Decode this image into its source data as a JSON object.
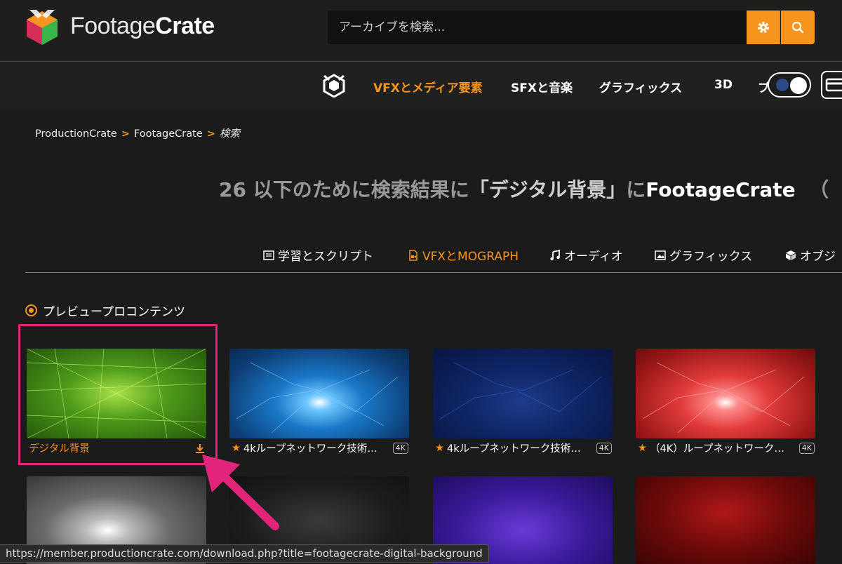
{
  "header": {
    "brand_light": "Footage",
    "brand_bold": "Crate",
    "search_placeholder": "アーカイブを検索..."
  },
  "nav": {
    "items": [
      "VFXとメディア要素",
      "SFXと音楽",
      "グラフィックス",
      "3D",
      "プ"
    ],
    "active_index": 0
  },
  "breadcrumb": {
    "items": [
      "ProductionCrate",
      "FootageCrate"
    ],
    "current": "検索"
  },
  "result": {
    "count": "26",
    "prefix": "以下のために検索結果に",
    "query": "「デジタル背景」",
    "mid": "に",
    "site": "FootageCrate",
    "tail": "（"
  },
  "tabs": [
    {
      "label": "学習とスクリプト",
      "icon": "script-icon"
    },
    {
      "label": "VFXとMOGRAPH",
      "icon": "video-icon"
    },
    {
      "label": "オーディオ",
      "icon": "music-icon"
    },
    {
      "label": "グラフィックス",
      "icon": "image-icon"
    },
    {
      "label": "オブジ",
      "icon": "cube-icon"
    }
  ],
  "preview_label": "プレビュープロコンテンツ",
  "cards": [
    {
      "title": "デジタル背景",
      "star": "",
      "badge": "",
      "color": "#f7941d"
    },
    {
      "title": "4kループネットワーク技術…",
      "star": "★",
      "badge": "4K"
    },
    {
      "title": "4kループネットワーク技術…",
      "star": "★",
      "badge": "4K"
    },
    {
      "title": "（4K）ループネットワーク…",
      "star": "★",
      "badge": "4K"
    }
  ],
  "status_url": "https://member.productioncrate.com/download.php?title=footagecrate-digital-background",
  "colors": {
    "accent": "#f7941d",
    "highlight": "#e2247b",
    "background": "#1b1b1b"
  }
}
